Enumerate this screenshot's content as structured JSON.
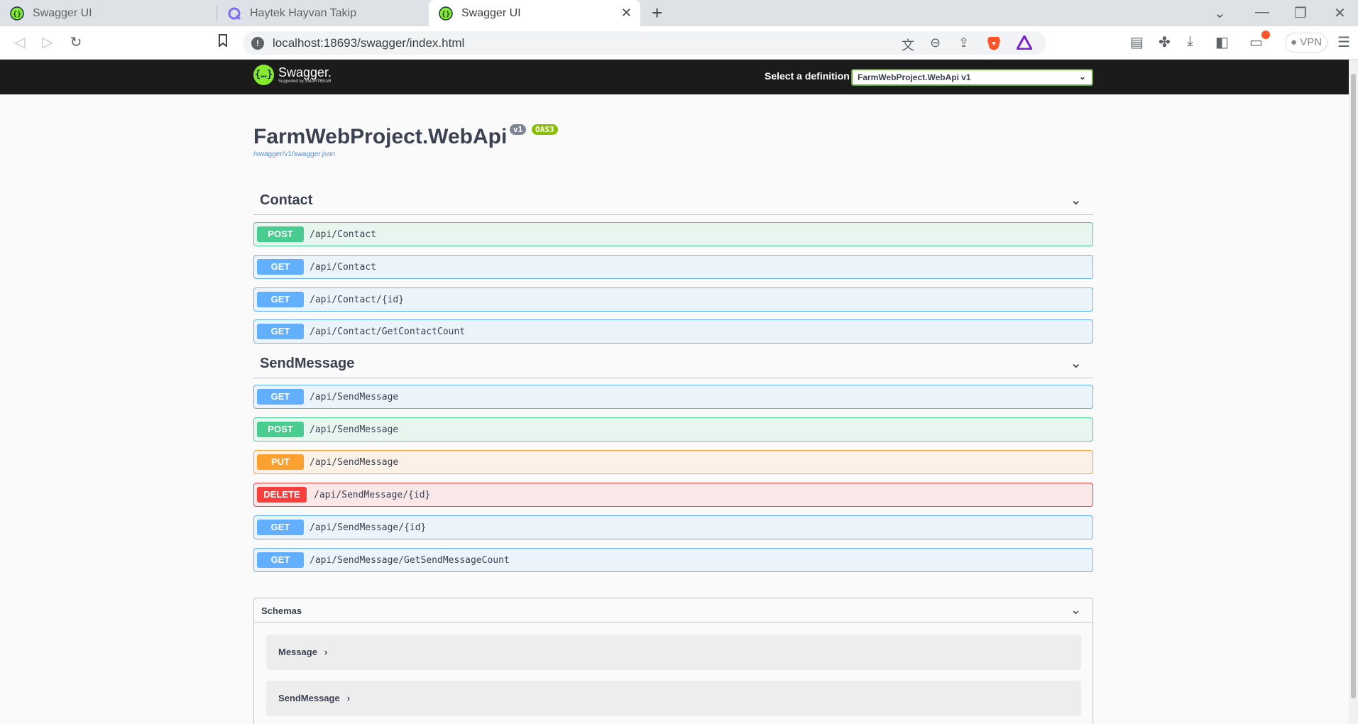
{
  "browser": {
    "tabs": [
      {
        "title": "Swagger UI",
        "icon": "swagger-favicon",
        "active": false
      },
      {
        "title": "Haytek Hayvan Takip",
        "icon": "q-favicon",
        "active": false
      },
      {
        "title": "Swagger UI",
        "icon": "swagger-favicon",
        "active": true
      }
    ],
    "url": "localhost:18693/swagger/index.html",
    "vpn_label": "VPN"
  },
  "swagger": {
    "logo_name": "Swagger.",
    "logo_sub": "Supported by SMARTBEAR",
    "select_label": "Select a definition",
    "selected_definition": "FarmWebProject.WebApi v1",
    "title": "FarmWebProject.WebApi",
    "version_badge": "v1",
    "oas_badge": "OAS3",
    "spec_link": "/swagger/v1/swagger.json"
  },
  "tags": [
    {
      "name": "Contact",
      "operations": [
        {
          "method": "POST",
          "path": "/api/Contact"
        },
        {
          "method": "GET",
          "path": "/api/Contact"
        },
        {
          "method": "GET",
          "path": "/api/Contact/{id}"
        },
        {
          "method": "GET",
          "path": "/api/Contact/GetContactCount"
        }
      ]
    },
    {
      "name": "SendMessage",
      "operations": [
        {
          "method": "GET",
          "path": "/api/SendMessage"
        },
        {
          "method": "POST",
          "path": "/api/SendMessage"
        },
        {
          "method": "PUT",
          "path": "/api/SendMessage"
        },
        {
          "method": "DELETE",
          "path": "/api/SendMessage/{id}"
        },
        {
          "method": "GET",
          "path": "/api/SendMessage/{id}"
        },
        {
          "method": "GET",
          "path": "/api/SendMessage/GetSendMessageCount"
        }
      ]
    }
  ],
  "schemas": {
    "title": "Schemas",
    "models": [
      "Message",
      "SendMessage"
    ]
  },
  "colors": {
    "post": "#49cc90",
    "get": "#61affe",
    "put": "#fca130",
    "delete": "#f93e3e",
    "topbar": "#1b1b1b"
  }
}
